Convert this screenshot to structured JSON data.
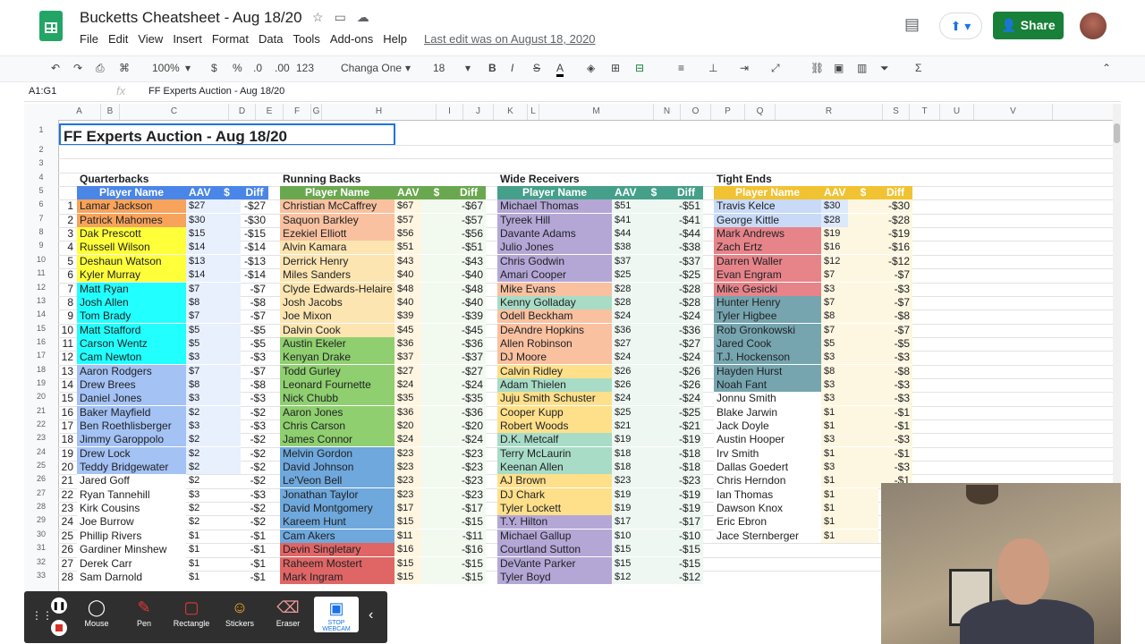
{
  "app": {
    "title": "Bucketts Cheatsheet - Aug 18/20",
    "last_edit": "Last edit was on August 18, 2020",
    "share": "Share"
  },
  "menu": [
    "File",
    "Edit",
    "View",
    "Insert",
    "Format",
    "Data",
    "Tools",
    "Add-ons",
    "Help"
  ],
  "toolbar": {
    "zoom": "100%",
    "currency": "$",
    "percent": "%",
    "dec_less": ".0",
    "dec_more": ".00",
    "format": "123",
    "font": "Changa One",
    "font_size": "18"
  },
  "formula": {
    "namebox": "A1:G1",
    "fx": "fx",
    "value": "FF Experts  Auction - Aug 18/20"
  },
  "columns": [
    "A",
    "B",
    "C",
    "D",
    "E",
    "F",
    "G",
    "H",
    "I",
    "J",
    "K",
    "L",
    "M",
    "N",
    "O",
    "P",
    "Q",
    "R",
    "S",
    "T",
    "U",
    "V"
  ],
  "rows": [
    "1",
    "2",
    "3",
    "4",
    "5",
    "6",
    "7",
    "8",
    "9",
    "10",
    "11",
    "12",
    "13",
    "14",
    "15",
    "16",
    "17",
    "18",
    "19",
    "20",
    "21",
    "22",
    "23",
    "24",
    "25",
    "26",
    "27",
    "28",
    "29",
    "30",
    "31",
    "32",
    "33"
  ],
  "sheet_title": "FF Experts Auction - Aug 18/20",
  "colors": {
    "orange": "#f7a35c",
    "yellow": "#ffff3a",
    "cyan": "#22ffff",
    "ltblue": "#a4c2f4",
    "qbwhite": "#ffffff",
    "salmon": "#f9c1a0",
    "peach": "#fce5b1",
    "green": "#8fcf6f",
    "blue": "#6fa8dc",
    "red": "#e06666",
    "purple": "#b4a7d6",
    "mint": "#a8dcc7",
    "yellow2": "#ffe08a",
    "pink": "#e6848a",
    "teal": "#76a5af",
    "lavblue": "#c9daf8"
  },
  "headers": {
    "player": "Player Name",
    "aav": "AAV",
    "dollar": "$",
    "diff": "Diff"
  },
  "sections": [
    {
      "name": "Quarterbacks",
      "hdr_color": "#4a86e8",
      "numbered": true,
      "players": [
        [
          "Lamar Jackson",
          "$27",
          "-$27",
          "orange"
        ],
        [
          "Patrick Mahomes",
          "$30",
          "-$30",
          "orange"
        ],
        [
          "Dak Prescott",
          "$15",
          "-$15",
          "yellow"
        ],
        [
          "Russell Wilson",
          "$14",
          "-$14",
          "yellow"
        ],
        [
          "Deshaun Watson",
          "$13",
          "-$13",
          "yellow"
        ],
        [
          "Kyler Murray",
          "$14",
          "-$14",
          "yellow"
        ],
        [
          "Matt Ryan",
          "$7",
          "-$7",
          "cyan"
        ],
        [
          "Josh Allen",
          "$8",
          "-$8",
          "cyan"
        ],
        [
          "Tom Brady",
          "$7",
          "-$7",
          "cyan"
        ],
        [
          "Matt Stafford",
          "$5",
          "-$5",
          "cyan"
        ],
        [
          "Carson Wentz",
          "$5",
          "-$5",
          "cyan"
        ],
        [
          "Cam Newton",
          "$3",
          "-$3",
          "cyan"
        ],
        [
          "Aaron Rodgers",
          "$7",
          "-$7",
          "ltblue"
        ],
        [
          "Drew Brees",
          "$8",
          "-$8",
          "ltblue"
        ],
        [
          "Daniel Jones",
          "$3",
          "-$3",
          "ltblue"
        ],
        [
          "Baker Mayfield",
          "$2",
          "-$2",
          "ltblue"
        ],
        [
          "Ben Roethlisberger",
          "$3",
          "-$3",
          "ltblue"
        ],
        [
          "Jimmy Garoppolo",
          "$2",
          "-$2",
          "ltblue"
        ],
        [
          "Drew Lock",
          "$2",
          "-$2",
          "ltblue"
        ],
        [
          "Teddy Bridgewater",
          "$2",
          "-$2",
          "ltblue"
        ],
        [
          "Jared Goff",
          "$2",
          "-$2",
          "qbwhite"
        ],
        [
          "Ryan Tannehill",
          "$3",
          "-$3",
          "qbwhite"
        ],
        [
          "Kirk Cousins",
          "$2",
          "-$2",
          "qbwhite"
        ],
        [
          "Joe Burrow",
          "$2",
          "-$2",
          "qbwhite"
        ],
        [
          "Phillip Rivers",
          "$1",
          "-$1",
          "qbwhite"
        ],
        [
          "Gardiner Minshew",
          "$1",
          "-$1",
          "qbwhite"
        ],
        [
          "Derek Carr",
          "$1",
          "-$1",
          "qbwhite"
        ],
        [
          "Sam Darnold",
          "$1",
          "-$1",
          "qbwhite"
        ]
      ]
    },
    {
      "name": "Running Backs",
      "hdr_color": "#6aa84f",
      "numbered": false,
      "players": [
        [
          "Christian McCaffrey",
          "$67",
          "-$67",
          "salmon"
        ],
        [
          "Saquon Barkley",
          "$57",
          "-$57",
          "salmon"
        ],
        [
          "Ezekiel Elliott",
          "$56",
          "-$56",
          "salmon"
        ],
        [
          "Alvin Kamara",
          "$51",
          "-$51",
          "peach"
        ],
        [
          "Derrick Henry",
          "$43",
          "-$43",
          "peach"
        ],
        [
          "Miles Sanders",
          "$40",
          "-$40",
          "peach"
        ],
        [
          "Clyde Edwards-Helaire",
          "$48",
          "-$48",
          "peach"
        ],
        [
          "Josh Jacobs",
          "$40",
          "-$40",
          "peach"
        ],
        [
          "Joe Mixon",
          "$39",
          "-$39",
          "peach"
        ],
        [
          "Dalvin Cook",
          "$45",
          "-$45",
          "peach"
        ],
        [
          "Austin Ekeler",
          "$36",
          "-$36",
          "green"
        ],
        [
          "Kenyan Drake",
          "$37",
          "-$37",
          "green"
        ],
        [
          "Todd Gurley",
          "$27",
          "-$27",
          "green"
        ],
        [
          "Leonard Fournette",
          "$24",
          "-$24",
          "green"
        ],
        [
          "Nick Chubb",
          "$35",
          "-$35",
          "green"
        ],
        [
          "Aaron Jones",
          "$36",
          "-$36",
          "green"
        ],
        [
          "Chris Carson",
          "$20",
          "-$20",
          "green"
        ],
        [
          "James Connor",
          "$24",
          "-$24",
          "green"
        ],
        [
          "Melvin Gordon",
          "$23",
          "-$23",
          "blue"
        ],
        [
          "David Johnson",
          "$23",
          "-$23",
          "blue"
        ],
        [
          "Le'Veon Bell",
          "$23",
          "-$23",
          "blue"
        ],
        [
          "Jonathan Taylor",
          "$23",
          "-$23",
          "blue"
        ],
        [
          "David Montgomery",
          "$17",
          "-$17",
          "blue"
        ],
        [
          "Kareem Hunt",
          "$15",
          "-$15",
          "blue"
        ],
        [
          "Cam Akers",
          "$11",
          "-$11",
          "blue"
        ],
        [
          "Devin Singletary",
          "$16",
          "-$16",
          "red"
        ],
        [
          "Raheem Mostert",
          "$15",
          "-$15",
          "red"
        ],
        [
          "Mark Ingram",
          "$15",
          "-$15",
          "red"
        ]
      ]
    },
    {
      "name": "Wide Receivers",
      "hdr_color": "#45a08a",
      "numbered": false,
      "players": [
        [
          "Michael Thomas",
          "$51",
          "-$51",
          "purple"
        ],
        [
          "Tyreek Hill",
          "$41",
          "-$41",
          "purple"
        ],
        [
          "Davante Adams",
          "$44",
          "-$44",
          "purple"
        ],
        [
          "Julio Jones",
          "$38",
          "-$38",
          "purple"
        ],
        [
          "Chris Godwin",
          "$37",
          "-$37",
          "purple"
        ],
        [
          "Amari Cooper",
          "$25",
          "-$25",
          "purple"
        ],
        [
          "Mike Evans",
          "$28",
          "-$28",
          "salmon"
        ],
        [
          "Kenny Golladay",
          "$28",
          "-$28",
          "mint"
        ],
        [
          "Odell Beckham",
          "$24",
          "-$24",
          "salmon"
        ],
        [
          "DeAndre Hopkins",
          "$36",
          "-$36",
          "salmon"
        ],
        [
          "Allen Robinson",
          "$27",
          "-$27",
          "salmon"
        ],
        [
          "DJ Moore",
          "$24",
          "-$24",
          "salmon"
        ],
        [
          "Calvin Ridley",
          "$26",
          "-$26",
          "yellow2"
        ],
        [
          "Adam Thielen",
          "$26",
          "-$26",
          "mint"
        ],
        [
          "Juju Smith Schuster",
          "$24",
          "-$24",
          "yellow2"
        ],
        [
          "Cooper Kupp",
          "$25",
          "-$25",
          "yellow2"
        ],
        [
          "Robert Woods",
          "$21",
          "-$21",
          "yellow2"
        ],
        [
          "D.K. Metcalf",
          "$19",
          "-$19",
          "mint"
        ],
        [
          "Terry McLaurin",
          "$18",
          "-$18",
          "mint"
        ],
        [
          "Keenan Allen",
          "$18",
          "-$18",
          "mint"
        ],
        [
          "AJ Brown",
          "$23",
          "-$23",
          "yellow2"
        ],
        [
          "DJ Chark",
          "$19",
          "-$19",
          "yellow2"
        ],
        [
          "Tyler Lockett",
          "$19",
          "-$19",
          "yellow2"
        ],
        [
          "T.Y. Hilton",
          "$17",
          "-$17",
          "purple"
        ],
        [
          "Michael Gallup",
          "$10",
          "-$10",
          "purple"
        ],
        [
          "Courtland Sutton",
          "$15",
          "-$15",
          "purple"
        ],
        [
          "DeVante Parker",
          "$15",
          "-$15",
          "purple"
        ],
        [
          "Tyler Boyd",
          "$12",
          "-$12",
          "purple"
        ]
      ]
    },
    {
      "name": "Tight Ends",
      "hdr_color": "#f1c232",
      "numbered": false,
      "players": [
        [
          "Travis Kelce",
          "$30",
          "-$30",
          "lavblue"
        ],
        [
          "George Kittle",
          "$28",
          "-$28",
          "lavblue"
        ],
        [
          "Mark Andrews",
          "$19",
          "-$19",
          "pink"
        ],
        [
          "Zach Ertz",
          "$16",
          "-$16",
          "pink"
        ],
        [
          "Darren Waller",
          "$12",
          "-$12",
          "pink"
        ],
        [
          "Evan Engram",
          "$7",
          "-$7",
          "pink"
        ],
        [
          "Mike Gesicki",
          "$3",
          "-$3",
          "pink"
        ],
        [
          "Hunter Henry",
          "$7",
          "-$7",
          "teal"
        ],
        [
          "Tyler Higbee",
          "$8",
          "-$8",
          "teal"
        ],
        [
          "Rob Gronkowski",
          "$7",
          "-$7",
          "teal"
        ],
        [
          "Jared Cook",
          "$5",
          "-$5",
          "teal"
        ],
        [
          "T.J. Hockenson",
          "$3",
          "-$3",
          "teal"
        ],
        [
          "Hayden Hurst",
          "$8",
          "-$8",
          "teal"
        ],
        [
          "Noah Fant",
          "$3",
          "-$3",
          "teal"
        ],
        [
          "Jonnu Smith",
          "$3",
          "-$3",
          "qbwhite"
        ],
        [
          "Blake Jarwin",
          "$1",
          "-$1",
          "qbwhite"
        ],
        [
          "Jack Doyle",
          "$1",
          "-$1",
          "qbwhite"
        ],
        [
          "Austin Hooper",
          "$3",
          "-$3",
          "qbwhite"
        ],
        [
          "Irv Smith",
          "$1",
          "-$1",
          "qbwhite"
        ],
        [
          "Dallas Goedert",
          "$3",
          "-$3",
          "qbwhite"
        ],
        [
          "Chris Herndon",
          "$1",
          "-$1",
          "qbwhite"
        ],
        [
          "Ian Thomas",
          "$1",
          "",
          "qbwhite"
        ],
        [
          "Dawson Knox",
          "$1",
          "",
          "qbwhite"
        ],
        [
          "Eric Ebron",
          "$1",
          "",
          "qbwhite"
        ],
        [
          "Jace Sternberger",
          "$1",
          "",
          "qbwhite"
        ]
      ]
    }
  ],
  "screencast": [
    {
      "label": "Mouse",
      "icon": "pointer-icon"
    },
    {
      "label": "Pen",
      "icon": "pen-icon"
    },
    {
      "label": "Rectangle",
      "icon": "rectangle-icon"
    },
    {
      "label": "Stickers",
      "icon": "sticker-icon"
    },
    {
      "label": "Eraser",
      "icon": "eraser-icon"
    },
    {
      "label": "STOP WEBCAM",
      "icon": "webcam-icon"
    }
  ]
}
